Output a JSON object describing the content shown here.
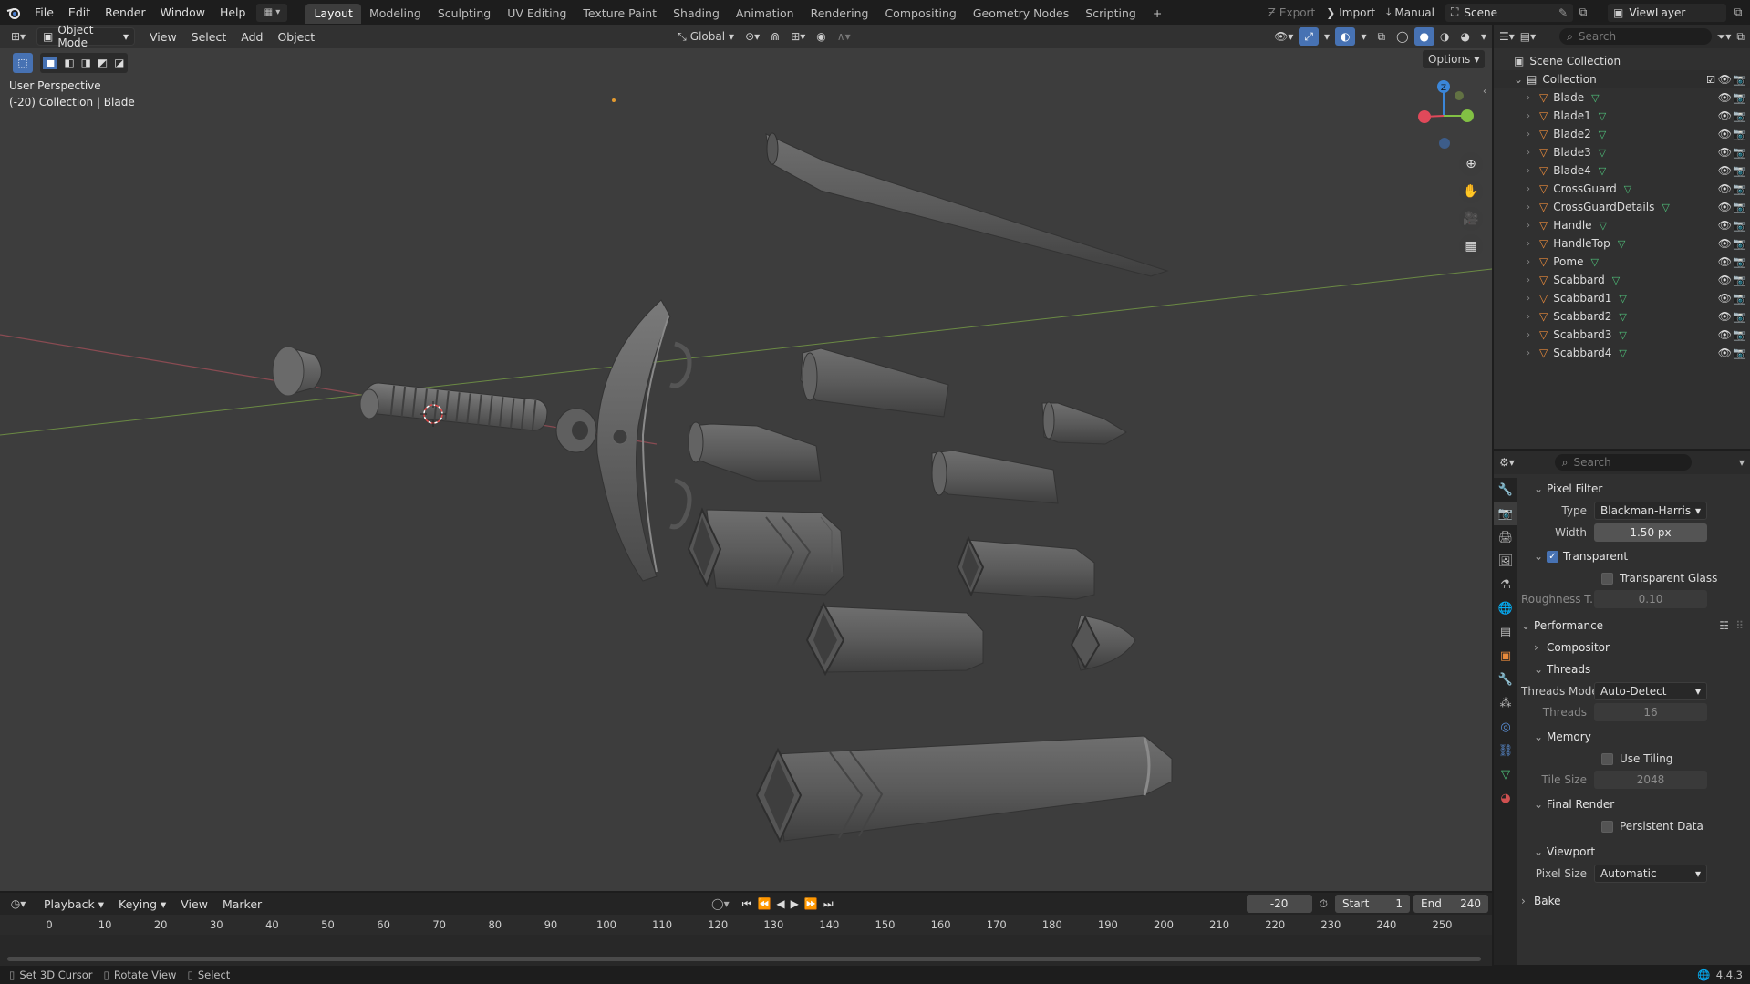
{
  "topbar": {
    "menus": [
      "File",
      "Edit",
      "Render",
      "Window",
      "Help"
    ],
    "workspaces": [
      "Layout",
      "Modeling",
      "Sculpting",
      "UV Editing",
      "Texture Paint",
      "Shading",
      "Animation",
      "Rendering",
      "Compositing",
      "Geometry Nodes",
      "Scripting"
    ],
    "active_workspace": "Layout",
    "add_tab": "+",
    "export_label": "Export",
    "import_label": "Import",
    "manual_label": "Manual",
    "scene_label": "Scene",
    "viewlayer_label": "ViewLayer"
  },
  "viewport": {
    "mode": "Object Mode",
    "menus": [
      "View",
      "Select",
      "Add",
      "Object"
    ],
    "orientation": "Global",
    "options_label": "Options",
    "perspective_text": "User Perspective",
    "collection_text": "(-20) Collection | Blade",
    "axes": {
      "x": "X",
      "y": "Y",
      "z": "Z"
    }
  },
  "outliner": {
    "search_placeholder": "Search",
    "scene_collection": "Scene Collection",
    "collection": "Collection",
    "objects": [
      "Blade",
      "Blade1",
      "Blade2",
      "Blade3",
      "Blade4",
      "CrossGuard",
      "CrossGuardDetails",
      "Handle",
      "HandleTop",
      "Pome",
      "Scabbard",
      "Scabbard1",
      "Scabbard2",
      "Scabbard3",
      "Scabbard4"
    ]
  },
  "properties": {
    "search_placeholder": "Search",
    "pixel_filter": {
      "title": "Pixel Filter",
      "type_label": "Type",
      "type_value": "Blackman-Harris",
      "width_label": "Width",
      "width_value": "1.50 px"
    },
    "transparent": {
      "title": "Transparent",
      "glass_label": "Transparent Glass",
      "roughness_label": "Roughness T...",
      "roughness_value": "0.10"
    },
    "performance": {
      "title": "Performance",
      "compositor": "Compositor",
      "threads": {
        "title": "Threads",
        "mode_label": "Threads Mode",
        "mode_value": "Auto-Detect",
        "threads_label": "Threads",
        "threads_value": "16"
      },
      "memory": {
        "title": "Memory",
        "tiling_label": "Use Tiling",
        "tile_size_label": "Tile Size",
        "tile_size_value": "2048"
      },
      "final_render": {
        "title": "Final Render",
        "persistent_label": "Persistent Data"
      },
      "viewport": {
        "title": "Viewport",
        "pixel_size_label": "Pixel Size",
        "pixel_size_value": "Automatic"
      }
    },
    "bake": "Bake"
  },
  "timeline": {
    "menus": [
      "Playback",
      "Keying",
      "View",
      "Marker"
    ],
    "current_frame": "-20",
    "start_label": "Start",
    "start_value": "1",
    "end_label": "End",
    "end_value": "240",
    "ticks": [
      "0",
      "10",
      "20",
      "30",
      "40",
      "50",
      "60",
      "70",
      "80",
      "90",
      "100",
      "110",
      "120",
      "130",
      "140",
      "150",
      "160",
      "170",
      "180",
      "190",
      "200",
      "210",
      "220",
      "230",
      "240",
      "250"
    ]
  },
  "statusbar": {
    "hints": [
      "Set 3D Cursor",
      "Rotate View",
      "Select"
    ],
    "version": "4.4.3"
  },
  "colors": {
    "accent": "#4772b3",
    "mesh_icon": "#e88a3b",
    "data_icon": "#4fc17a",
    "x_axis": "#e0495a",
    "y_axis": "#82c044",
    "z_axis": "#3b86d8"
  }
}
